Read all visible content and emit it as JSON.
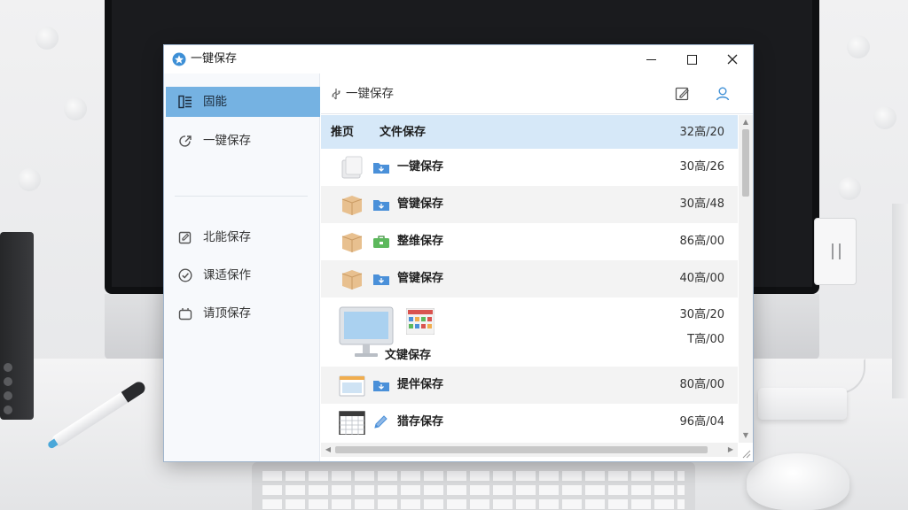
{
  "window": {
    "title": "一键保存",
    "controls": {
      "minimize": "minimize",
      "maximize": "maximize",
      "close": "close"
    }
  },
  "sidebar": {
    "items": [
      {
        "label": "固能",
        "icon": "list-view-icon",
        "active": true
      },
      {
        "label": "一键保存",
        "icon": "share-arrow-icon",
        "active": false
      },
      {
        "label": "北能保存",
        "icon": "edit-box-icon",
        "active": false
      },
      {
        "label": "课适保作",
        "icon": "check-circle-icon",
        "active": false
      },
      {
        "label": "请顶保存",
        "icon": "bag-icon",
        "active": false
      }
    ]
  },
  "toolbar": {
    "breadcrumb": "一键保存",
    "breadcrumb_icon": "usb-icon",
    "actions": [
      {
        "name": "edit-icon"
      },
      {
        "name": "user-icon"
      }
    ]
  },
  "list": {
    "header": {
      "col1": "推页",
      "col2": "文件保存",
      "col3": "32高/20"
    },
    "rows": [
      {
        "name": "一键保存",
        "size": "30高/26",
        "thumb": "blank-folder-icon",
        "type_icon": "blue-folder-icon"
      },
      {
        "name": "管键保存",
        "size": "30高/48",
        "thumb": "package-folder-icon",
        "type_icon": "blue-folder-icon"
      },
      {
        "name": "整维保存",
        "size": "86高/00",
        "thumb": "package-folder-icon",
        "type_icon": "green-toolbox-icon"
      },
      {
        "name": "管键保存",
        "size": "40高/00",
        "thumb": "package-folder-icon",
        "type_icon": "blue-folder-icon"
      }
    ],
    "big_row": {
      "name": "文键保存",
      "size1": "30高/20",
      "size2": "T高/00",
      "thumb": "monitor-icon",
      "type_icon": "app-grid-icon"
    },
    "rows2": [
      {
        "name": "提伴保存",
        "size": "80高/00",
        "thumb": "window-thumb-icon",
        "type_icon": "blue-folder-icon"
      },
      {
        "name": "猎存保存",
        "size": "96高/04",
        "thumb": "calendar-thumb-icon",
        "type_icon": "pencil-icon"
      }
    ]
  },
  "colors": {
    "accent": "#75b2e2",
    "header_bg": "#d6e8f8",
    "folder_blue": "#4a90d9",
    "toolbox_green": "#5cb85c"
  }
}
